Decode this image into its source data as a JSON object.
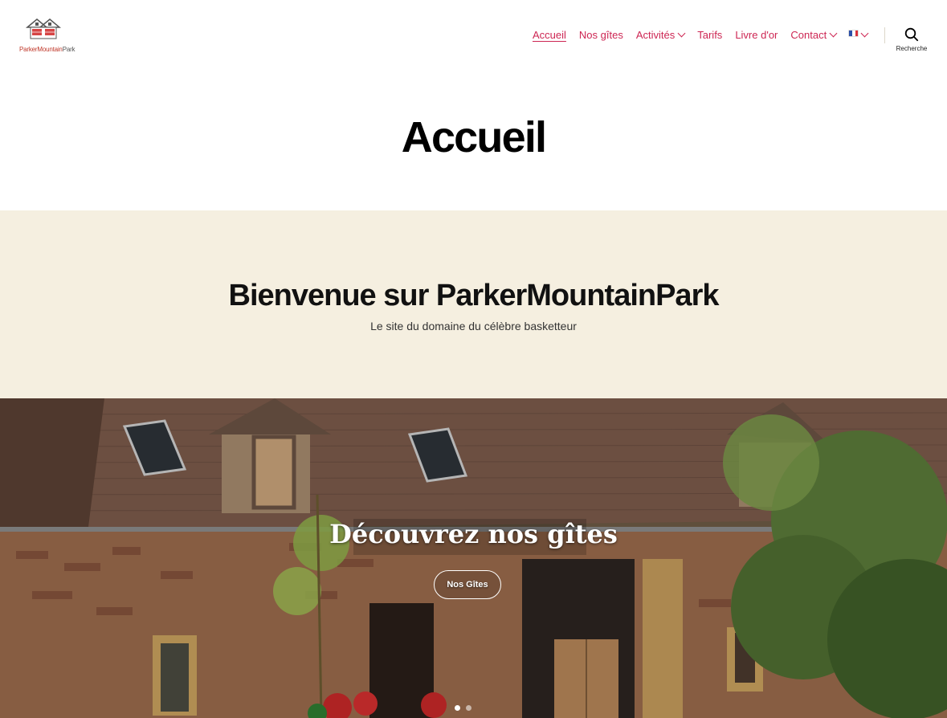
{
  "brand": {
    "name_part1": "Parker",
    "name_part2": "Mountain",
    "name_part3": "Park"
  },
  "nav": {
    "items": [
      {
        "label": "Accueil",
        "current": true,
        "has_dropdown": false
      },
      {
        "label": "Nos gîtes",
        "current": false,
        "has_dropdown": false
      },
      {
        "label": "Activités",
        "current": false,
        "has_dropdown": true
      },
      {
        "label": "Tarifs",
        "current": false,
        "has_dropdown": false
      },
      {
        "label": "Livre d'or",
        "current": false,
        "has_dropdown": false
      },
      {
        "label": "Contact",
        "current": false,
        "has_dropdown": true
      }
    ],
    "language_flag": "fr-flag-icon",
    "search_label": "Recherche"
  },
  "page": {
    "title": "Accueil"
  },
  "intro": {
    "heading": "Bienvenue sur ParkerMountainPark",
    "subtitle": "Le site du domaine du célèbre basketteur"
  },
  "hero": {
    "title": "Découvrez nos gîtes",
    "button_label": "Nos Gîtes",
    "slides_count": 2,
    "active_slide": 1
  },
  "colors": {
    "accent": "#cd2653",
    "intro_bg": "#f5efe0",
    "text": "#000000"
  }
}
